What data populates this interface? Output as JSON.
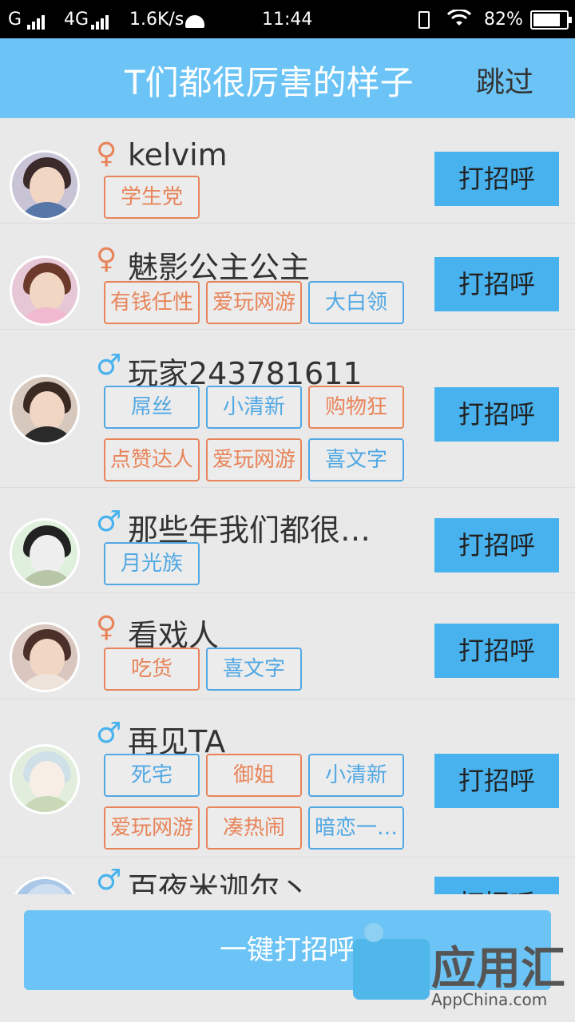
{
  "status_bar": {
    "carrier1": "G",
    "carrier2": "4G",
    "speed": "1.6K/s",
    "time": "11:44",
    "battery": "82%",
    "battery_level": 0.82
  },
  "header": {
    "title": "T们都很厉害的样子",
    "skip": "跳过"
  },
  "greet_label": "打招呼",
  "users": [
    {
      "gender": "♀",
      "name": "kelvim",
      "tags": [
        {
          "text": "学生党",
          "color": "o"
        }
      ]
    },
    {
      "gender": "♀",
      "name": "魅影公主公主",
      "tags": [
        {
          "text": "有钱任性",
          "color": "o"
        },
        {
          "text": "爱玩网游",
          "color": "o"
        },
        {
          "text": "大白领",
          "color": "b"
        }
      ]
    },
    {
      "gender": "♂",
      "name": "玩家243781611",
      "tags": [
        {
          "text": "屌丝",
          "color": "b"
        },
        {
          "text": "小清新",
          "color": "b"
        },
        {
          "text": "购物狂",
          "color": "o"
        },
        {
          "text": "点赞达人",
          "color": "o"
        },
        {
          "text": "爱玩网游",
          "color": "o"
        },
        {
          "text": "喜文字",
          "color": "b"
        }
      ]
    },
    {
      "gender": "♂",
      "name": "那些年我们都很…",
      "tags": [
        {
          "text": "月光族",
          "color": "b"
        }
      ]
    },
    {
      "gender": "♀",
      "name": "看戏人_",
      "tags": [
        {
          "text": "吃货",
          "color": "o"
        },
        {
          "text": "喜文字",
          "color": "b"
        }
      ]
    },
    {
      "gender": "♂",
      "name": "再见TA",
      "tags": [
        {
          "text": "死宅",
          "color": "b"
        },
        {
          "text": "御姐",
          "color": "o"
        },
        {
          "text": "小清新",
          "color": "b"
        },
        {
          "text": "爱玩网游",
          "color": "o"
        },
        {
          "text": "凑热闹",
          "color": "o"
        },
        {
          "text": "暗恋一…",
          "color": "b"
        }
      ]
    },
    {
      "gender": "♂",
      "name": "百夜米迦尔丶",
      "tags": []
    }
  ],
  "bottom_button": "一键打招呼",
  "watermark": {
    "text": "应用汇",
    "sub": "AppChina.com"
  }
}
